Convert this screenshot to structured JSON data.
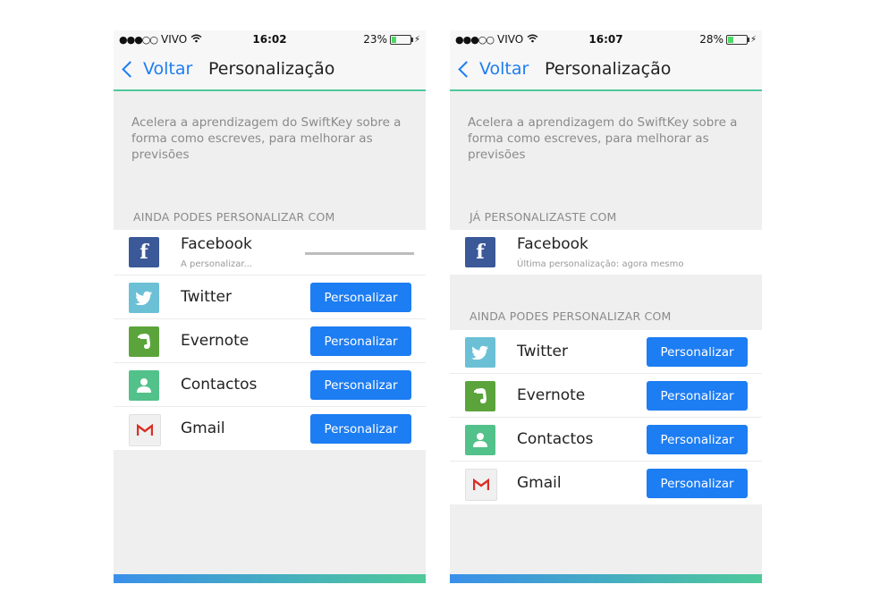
{
  "status_icons": {
    "wifi": "wifi-icon",
    "battery": "battery-icon",
    "charging": "bolt-icon"
  },
  "colors": {
    "accent": "#1d7df2",
    "header_line": "#4fc99a",
    "facebook": "#3b5998",
    "twitter": "#6bc0d6",
    "evernote": "#5ba43b",
    "contacts": "#52c18a",
    "gmail_red": "#d93025"
  },
  "left": {
    "status": {
      "signal_dots": "●●●○○",
      "carrier": "VIVO",
      "time": "16:02",
      "battery": "23%",
      "battery_level": 0.23
    },
    "nav": {
      "back": "Voltar",
      "title": "Personalização"
    },
    "description": "Acelera a aprendizagem do SwiftKey sobre a forma como escreves, para melhorar as previsões",
    "section_header": "AINDA PODES PERSONALIZAR COM",
    "facebook": {
      "name": "Facebook",
      "status": "A personalizar...",
      "progress": 0.0
    },
    "items": [
      {
        "name": "Twitter",
        "button": "Personalizar",
        "icon": "twitter-icon"
      },
      {
        "name": "Evernote",
        "button": "Personalizar",
        "icon": "evernote-icon"
      },
      {
        "name": "Contactos",
        "button": "Personalizar",
        "icon": "contacts-icon"
      },
      {
        "name": "Gmail",
        "button": "Personalizar",
        "icon": "gmail-icon"
      }
    ]
  },
  "right": {
    "status": {
      "signal_dots": "●●●○○",
      "carrier": "VIVO",
      "time": "16:07",
      "battery": "28%",
      "battery_level": 0.28
    },
    "nav": {
      "back": "Voltar",
      "title": "Personalização"
    },
    "description": "Acelera a aprendizagem do SwiftKey sobre a forma como escreves, para melhorar as previsões",
    "section_header_done": "JÁ PERSONALIZASTE COM",
    "facebook": {
      "name": "Facebook",
      "status": "Última personalização: agora mesmo"
    },
    "section_header": "AINDA PODES PERSONALIZAR COM",
    "items": [
      {
        "name": "Twitter",
        "button": "Personalizar",
        "icon": "twitter-icon"
      },
      {
        "name": "Evernote",
        "button": "Personalizar",
        "icon": "evernote-icon"
      },
      {
        "name": "Contactos",
        "button": "Personalizar",
        "icon": "contacts-icon"
      },
      {
        "name": "Gmail",
        "button": "Personalizar",
        "icon": "gmail-icon"
      }
    ]
  }
}
